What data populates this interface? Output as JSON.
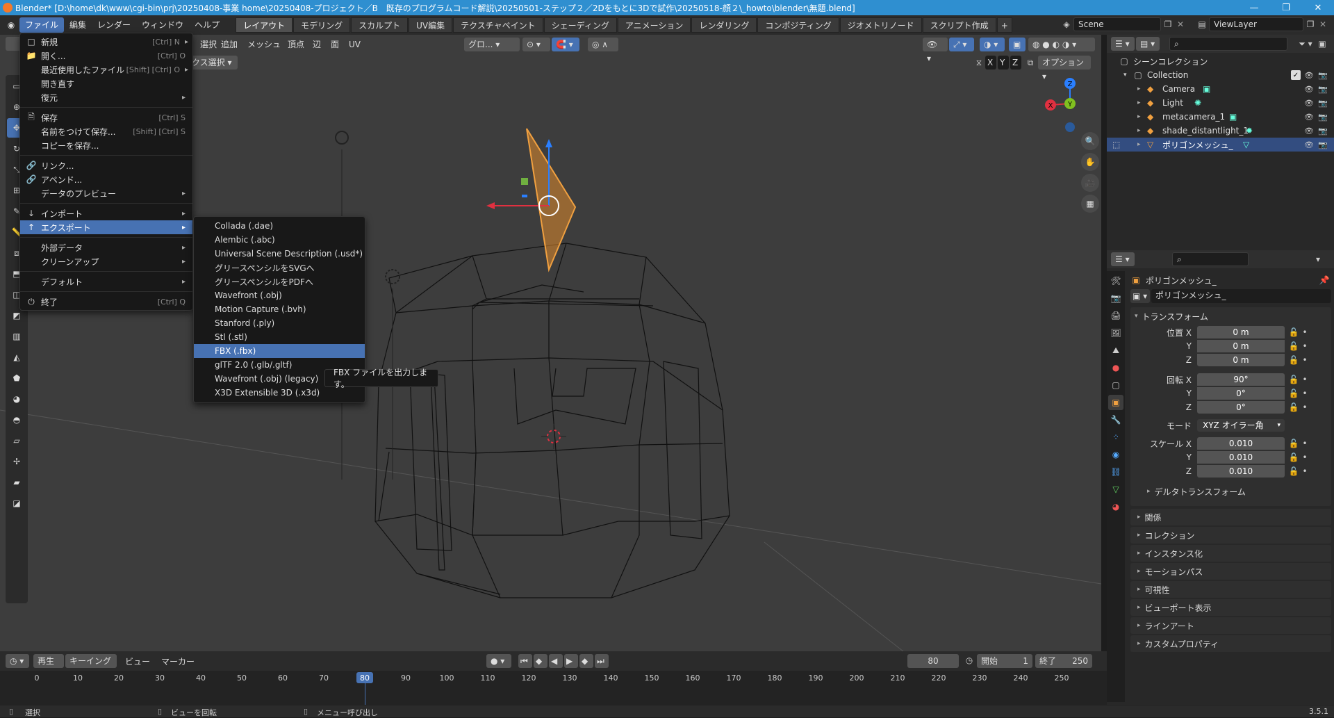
{
  "window": {
    "title": "Blender* [D:\\home\\dk\\www\\cgi-bin\\prj\\20250408-事業 home\\20250408-プロジェクト／B　既存のプログラムコード解説\\20250501-ステップ２／2Dをもとに3Dで試作\\20250518-顔２\\_howto\\blender\\無題.blend]",
    "minimize": "—",
    "restore": "❐",
    "close": "✕"
  },
  "menubar": {
    "items": [
      "ファイル",
      "編集",
      "レンダー",
      "ウィンドウ",
      "ヘルプ"
    ]
  },
  "workspaces": [
    "レイアウト",
    "モデリング",
    "スカルプト",
    "UV編集",
    "テクスチャペイント",
    "シェーディング",
    "アニメーション",
    "レンダリング",
    "コンポジティング",
    "ジオメトリノード",
    "スクリプト作成"
  ],
  "workspace_add": "+",
  "scene": {
    "scene_label": "Scene",
    "viewlayer_label": "ViewLayer"
  },
  "viewport_header": {
    "menus": [
      "選択",
      "追加",
      "メッシュ",
      "頂点",
      "辺",
      "面",
      "UV"
    ],
    "transform": "グロ...",
    "select_mode": "クス選択",
    "axes": [
      "X",
      "Y",
      "Z"
    ],
    "options": "オプション"
  },
  "file_menu": {
    "items": [
      {
        "label": "新規",
        "shortcut": "[Ctrl] N",
        "arrow": "▸",
        "icon": ""
      },
      {
        "label": "開く...",
        "shortcut": "[Ctrl] O",
        "arrow": "",
        "icon": "📁"
      },
      {
        "label": "最近使用したファイル",
        "shortcut": "[Shift] [Ctrl] O",
        "arrow": "▸",
        "icon": ""
      },
      {
        "label": "開き直す",
        "shortcut": "",
        "arrow": "",
        "icon": ""
      },
      {
        "label": "復元",
        "shortcut": "",
        "arrow": "▸",
        "icon": ""
      },
      {
        "label": "保存",
        "shortcut": "[Ctrl] S",
        "arrow": "",
        "icon": "🗎"
      },
      {
        "label": "名前をつけて保存...",
        "shortcut": "[Shift] [Ctrl] S",
        "arrow": "",
        "icon": ""
      },
      {
        "label": "コピーを保存...",
        "shortcut": "",
        "arrow": "",
        "icon": ""
      },
      {
        "label": "リンク...",
        "shortcut": "",
        "arrow": "",
        "icon": "🔗"
      },
      {
        "label": "アペンド...",
        "shortcut": "",
        "arrow": "",
        "icon": "🔗"
      },
      {
        "label": "データのプレビュー",
        "shortcut": "",
        "arrow": "▸",
        "icon": ""
      },
      {
        "label": "インポート",
        "shortcut": "",
        "arrow": "▸",
        "icon": "↓"
      },
      {
        "label": "エクスポート",
        "shortcut": "",
        "arrow": "▸",
        "icon": "↑"
      },
      {
        "label": "外部データ",
        "shortcut": "",
        "arrow": "▸",
        "icon": ""
      },
      {
        "label": "クリーンアップ",
        "shortcut": "",
        "arrow": "▸",
        "icon": ""
      },
      {
        "label": "デフォルト",
        "shortcut": "",
        "arrow": "▸",
        "icon": ""
      },
      {
        "label": "終了",
        "shortcut": "[Ctrl] Q",
        "arrow": "",
        "icon": "⏻"
      }
    ]
  },
  "export_menu": {
    "items": [
      "Collada (.dae)",
      "Alembic (.abc)",
      "Universal Scene Description (.usd*)",
      "グリースペンシルをSVGへ",
      "グリースペンシルをPDFへ",
      "Wavefront (.obj)",
      "Motion Capture (.bvh)",
      "Stanford (.ply)",
      "Stl (.stl)",
      "FBX (.fbx)",
      "glTF 2.0 (.glb/.gltf)",
      "Wavefront (.obj) (legacy)",
      "X3D Extensible 3D (.x3d)"
    ],
    "highlighted": "FBX (.fbx)"
  },
  "tooltip": "FBX ファイルを出力します。",
  "gizmo": {
    "x": "X",
    "y": "Y",
    "z": "Z"
  },
  "outliner": {
    "root": "シーンコレクション",
    "collection": "Collection",
    "objects": [
      "Camera",
      "Light",
      "metacamera_1",
      "shade_distantlight_1",
      "ポリゴンメッシュ_"
    ]
  },
  "properties": {
    "object_name": "ポリゴンメッシュ_",
    "data_name": "ポリゴンメッシュ_",
    "transform_title": "トランスフォーム",
    "location_label": "位置 X",
    "location": [
      "0 m",
      "0 m",
      "0 m"
    ],
    "rotation_label": "回転 X",
    "rotation": [
      "90°",
      "0°",
      "0°"
    ],
    "mode_label": "モード",
    "mode_value": "XYZ オイラー角",
    "scale_label": "スケール X",
    "scale": [
      "0.010",
      "0.010",
      "0.010"
    ],
    "axis_y": "Y",
    "axis_z": "Z",
    "delta": "デルタトランスフォーム",
    "panels": [
      "関係",
      "コレクション",
      "インスタンス化",
      "モーションパス",
      "可視性",
      "ビューポート表示",
      "ラインアート",
      "カスタムプロパティ"
    ]
  },
  "timeline": {
    "menus": [
      "再生",
      "キーイング",
      "ビュー",
      "マーカー"
    ],
    "current_frame": "80",
    "start_label": "開始",
    "start": "1",
    "end_label": "終了",
    "end": "250",
    "ticks": [
      "0",
      "10",
      "20",
      "30",
      "40",
      "50",
      "60",
      "70",
      "80",
      "90",
      "100",
      "110",
      "120",
      "130",
      "140",
      "150",
      "160",
      "170",
      "180",
      "190",
      "200",
      "210",
      "220",
      "230",
      "240",
      "250"
    ]
  },
  "statusbar": {
    "left": "選択",
    "mid": "ビューを回転",
    "right": "メニュー呼び出し",
    "version": "3.5.1"
  }
}
